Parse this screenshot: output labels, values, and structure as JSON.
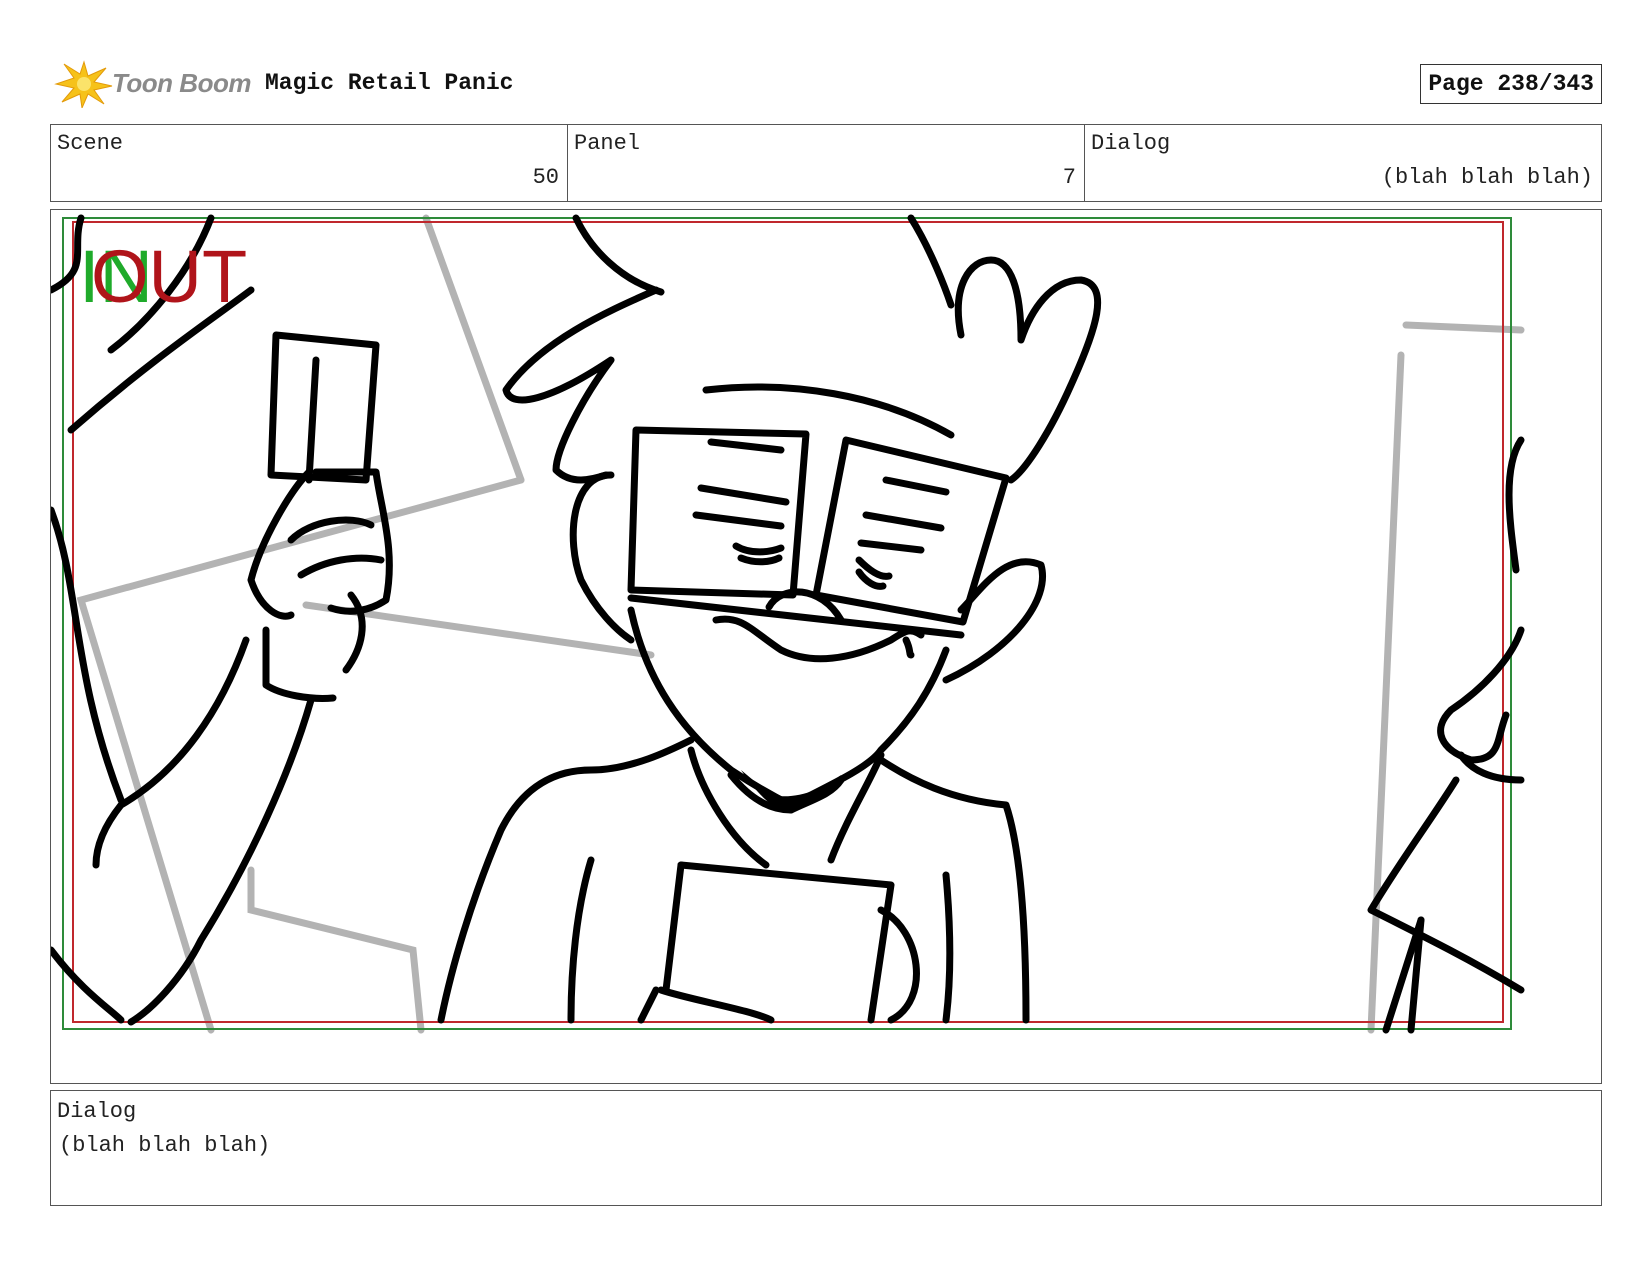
{
  "header": {
    "logo_text": "Toon Boom",
    "project_title": "Magic Retail Panic",
    "page_label": "Page 238/343"
  },
  "info": {
    "scene_label": "Scene",
    "scene_value": "50",
    "panel_label": "Panel",
    "panel_value": "7",
    "dialog_label": "Dialog",
    "dialog_value": "(blah blah blah)"
  },
  "panel": {
    "in_marker": "IN",
    "out_marker": "OUT",
    "in_color": "#1faa2a",
    "out_color": "#b0141a",
    "safe_area_outer_color": "#2e8b3a",
    "safe_area_inner_color": "#c0282d"
  },
  "dialog_box": {
    "label": "Dialog",
    "text": "(blah blah blah)"
  }
}
